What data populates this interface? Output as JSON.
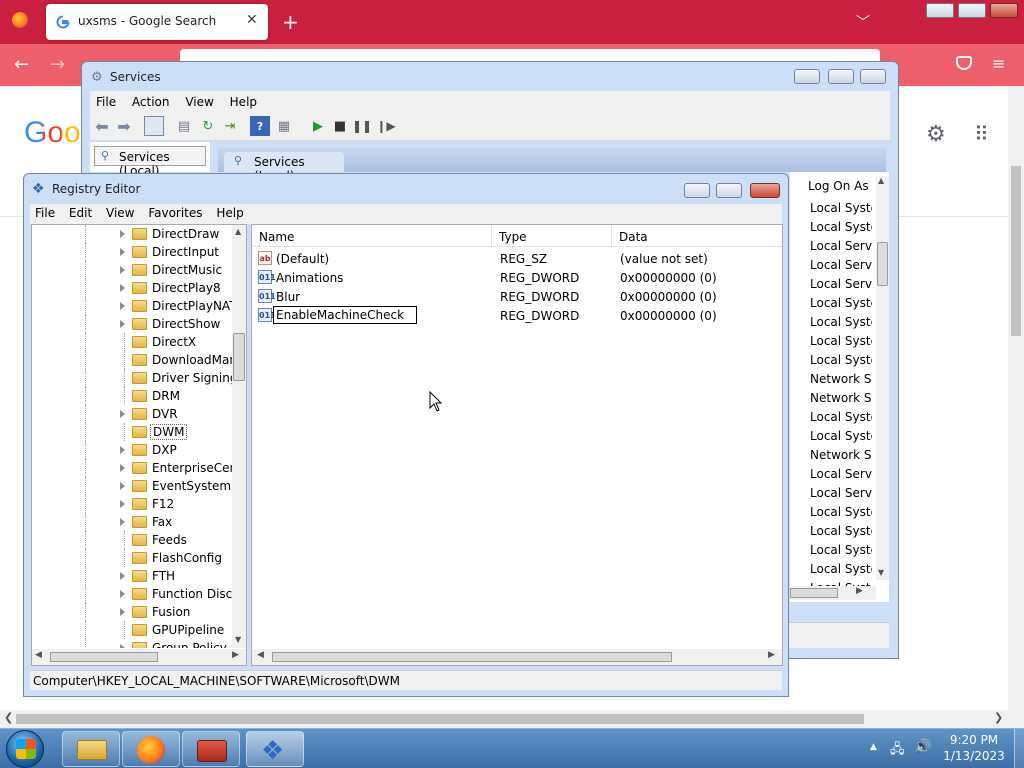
{
  "browser": {
    "tab_title": "uxsms - Google Search",
    "google_logo_partial": "Goo",
    "colors": {
      "titlebar": "#c9203f",
      "navbar": "#ec5f6b"
    }
  },
  "services": {
    "title": "Services",
    "menu": [
      "File",
      "Action",
      "View",
      "Help"
    ],
    "left_tab": "Services (Local)",
    "header_tab": "Services (Local)",
    "column_logon": "Log On As",
    "logon_values": [
      "Local Syste...",
      "Local Syste...",
      "Local Servic",
      "Local Servic",
      "Local Servic",
      "Local Syste...",
      "Local Syste...",
      "Local Syste...",
      "Local Syste...",
      "Network S...",
      "Network S...",
      "Local Syste...",
      "Local Syste...",
      "Network S...",
      "Local Servic",
      "Local Servic",
      "Local Syste...",
      "Local Syste...",
      "Local Syste...",
      "Local Syste...",
      "Local Syste..."
    ]
  },
  "regedit": {
    "title": "Registry Editor",
    "menu": [
      "File",
      "Edit",
      "View",
      "Favorites",
      "Help"
    ],
    "tree": [
      "DirectDraw",
      "DirectInput",
      "DirectMusic",
      "DirectPlay8",
      "DirectPlayNAT",
      "DirectShow",
      "DirectX",
      "DownloadMan",
      "Driver Signing",
      "DRM",
      "DVR",
      "DWM",
      "DXP",
      "EnterpriseCerti",
      "EventSystem",
      "F12",
      "Fax",
      "Feeds",
      "FlashConfig",
      "FTH",
      "Function Disco",
      "Fusion",
      "GPUPipeline",
      "Group Policy"
    ],
    "tree_expandable": [
      true,
      true,
      true,
      true,
      true,
      true,
      false,
      false,
      false,
      false,
      true,
      false,
      true,
      true,
      true,
      true,
      true,
      false,
      false,
      true,
      true,
      true,
      false,
      true
    ],
    "selected_key": "DWM",
    "columns": {
      "name": "Name",
      "type": "Type",
      "data": "Data"
    },
    "values": [
      {
        "name": "(Default)",
        "type": "REG_SZ",
        "data": "(value not set)",
        "icon": "string-value-icon",
        "glyph": "ab"
      },
      {
        "name": "Animations",
        "type": "REG_DWORD",
        "data": "0x00000000 (0)",
        "icon": "dword-value-icon",
        "glyph": "011"
      },
      {
        "name": "Blur",
        "type": "REG_DWORD",
        "data": "0x00000000 (0)",
        "icon": "dword-value-icon",
        "glyph": "011"
      },
      {
        "name": "EnableMachineCheck",
        "type": "REG_DWORD",
        "data": "0x00000000 (0)",
        "icon": "dword-value-icon",
        "glyph": "011",
        "editing": true
      }
    ],
    "status_path": "Computer\\HKEY_LOCAL_MACHINE\\SOFTWARE\\Microsoft\\DWM"
  },
  "taskbar": {
    "apps": [
      "firefox-icon",
      "file-explorer-icon",
      "toolbox-icon",
      "registry-editor-icon"
    ],
    "clock_time": "9:20 PM",
    "clock_date": "1/13/2023"
  }
}
